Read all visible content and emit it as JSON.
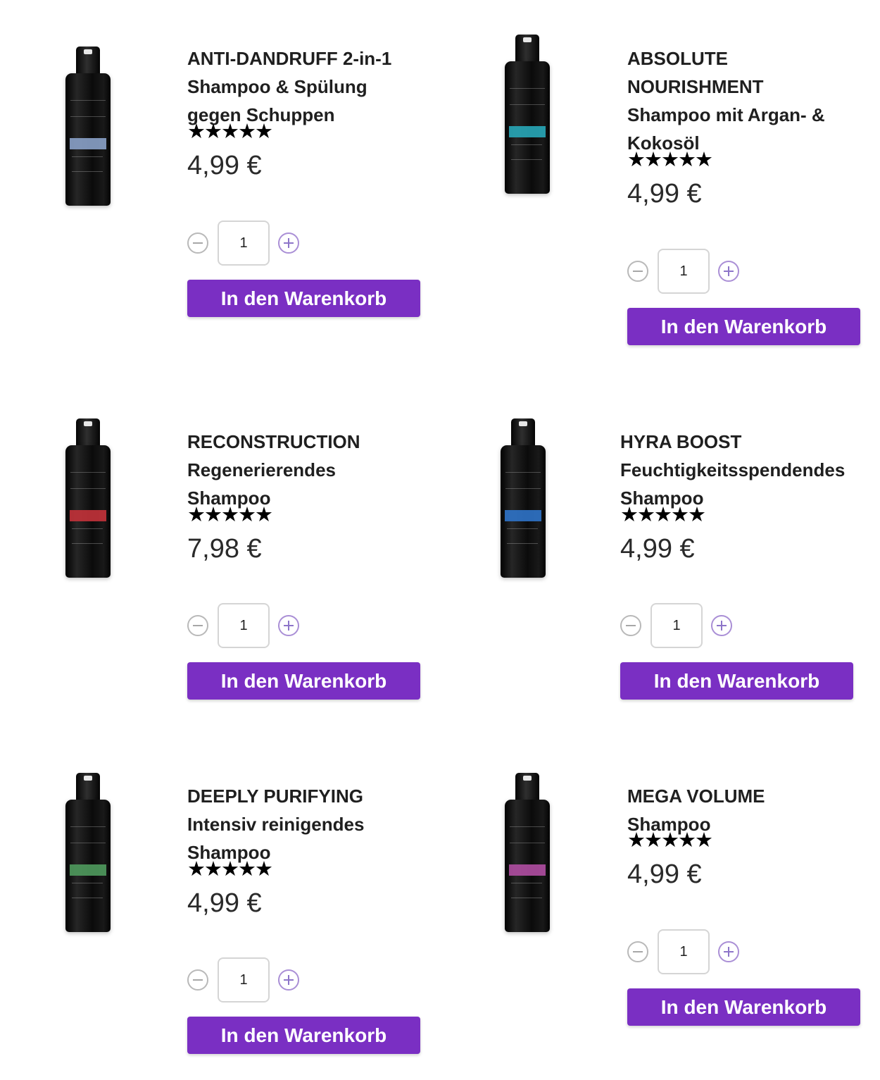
{
  "products": [
    {
      "title_lines": [
        "ANTI-DANDRUFF 2-in-1",
        "Shampoo & Spülung",
        "gegen Schuppen"
      ],
      "rating_stars": "★★★★★",
      "rating": 5,
      "price": "4,99 €",
      "quantity": "1",
      "cart_label": "In den Warenkorb",
      "label_color": "#8aa1c8"
    },
    {
      "title_lines": [
        "ABSOLUTE",
        "NOURISHMENT",
        "Shampoo mit Argan- &",
        "Kokosöl"
      ],
      "rating_stars": "★★★★★",
      "rating": 5,
      "price": "4,99 €",
      "quantity": "1",
      "cart_label": "In den Warenkorb",
      "label_color": "#28a7b8"
    },
    {
      "title_lines": [
        "RECONSTRUCTION",
        "Regenerierendes",
        "Shampoo"
      ],
      "rating_stars": "★★★★★",
      "rating": 5,
      "price": "7,98 €",
      "quantity": "1",
      "cart_label": "In den Warenkorb",
      "label_color": "#c3323a"
    },
    {
      "title_lines": [
        "HYRA BOOST",
        "Feuchtigkeitsspendendes",
        "Shampoo"
      ],
      "rating_stars": "★★★★★",
      "rating": 4.5,
      "price": "4,99 €",
      "quantity": "1",
      "cart_label": "In den Warenkorb",
      "label_color": "#2f73c8"
    },
    {
      "title_lines": [
        "DEEPLY PURIFYING",
        "Intensiv reinigendes",
        "Shampoo"
      ],
      "rating_stars": "★★★★★",
      "rating": 5,
      "price": "4,99 €",
      "quantity": "1",
      "cart_label": "In den Warenkorb",
      "label_color": "#4f9a5d"
    },
    {
      "title_lines": [
        "MEGA VOLUME",
        "Shampoo"
      ],
      "rating_stars": "★★★★★",
      "rating": 5,
      "price": "4,99 €",
      "quantity": "1",
      "cart_label": "In den Warenkorb",
      "label_color": "#b04ea2"
    }
  ],
  "colors": {
    "button": "#7a2fc3",
    "stars": "#000000",
    "plus_icon": "#8d75c9",
    "minus_icon": "#a7a7a7"
  },
  "icons": {
    "decrease": "minus-circle-icon",
    "increase": "plus-circle-icon",
    "rating": "star-icon"
  }
}
